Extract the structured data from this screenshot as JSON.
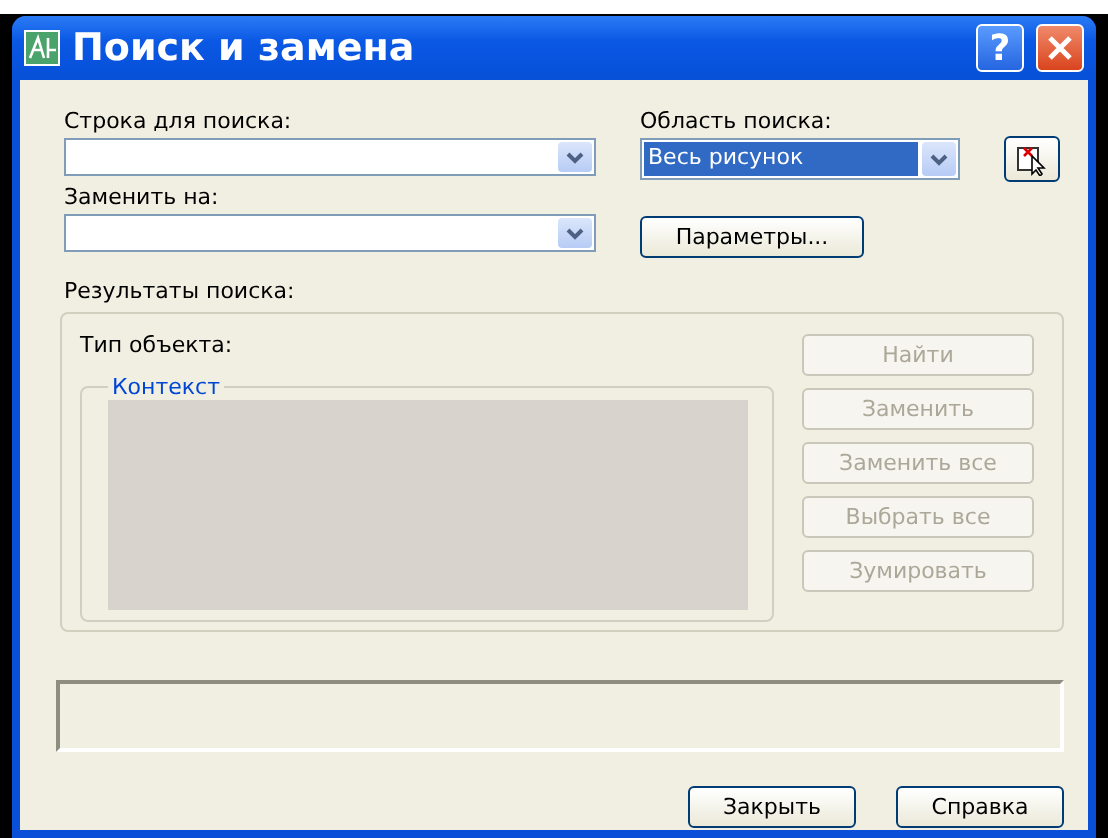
{
  "window": {
    "title": "Поиск и замена",
    "help_button": "?"
  },
  "search_field": {
    "label": "Строка для поиска:"
  },
  "replace_field": {
    "label": "Заменить на:"
  },
  "search_area": {
    "label": "Область поиска:",
    "value": "Весь рисунок",
    "highlighted": true
  },
  "options_button": {
    "label": "Параметры..."
  },
  "results": {
    "label": "Результаты поиска:",
    "object_type_label": "Тип объекта:",
    "context_label": "Контекст",
    "actions": [
      {
        "label": "Найти",
        "disabled": true
      },
      {
        "label": "Заменить",
        "disabled": true
      },
      {
        "label": "Заменить все",
        "disabled": true
      },
      {
        "label": "Выбрать все",
        "disabled": true
      },
      {
        "label": "Зумировать",
        "disabled": true
      }
    ]
  },
  "footer_buttons": [
    {
      "label": "Закрыть",
      "disabled": false
    },
    {
      "label": "Справка",
      "disabled": false
    }
  ]
}
